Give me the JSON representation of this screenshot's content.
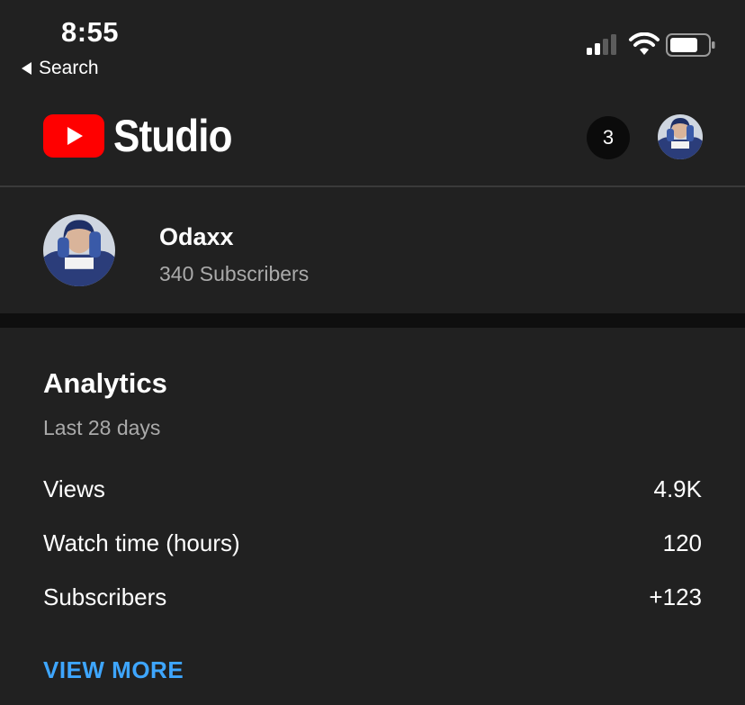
{
  "status_bar": {
    "time": "8:55",
    "back_label": "Search",
    "signal_icon": "cellular-signal-icon",
    "wifi_icon": "wifi-icon",
    "battery_icon": "battery-icon"
  },
  "header": {
    "logo_text": "Studio",
    "logo_icon": "youtube-play-icon",
    "notification_count": "3",
    "brand_color": "#ff0000"
  },
  "channel": {
    "name": "Odaxx",
    "subscribers": "340 Subscribers"
  },
  "analytics": {
    "title": "Analytics",
    "range": "Last 28 days",
    "metrics": [
      {
        "label": "Views",
        "value": "4.9K"
      },
      {
        "label": "Watch time (hours)",
        "value": "120"
      },
      {
        "label": "Subscribers",
        "value": "+123"
      }
    ],
    "view_more_label": "VIEW MORE",
    "link_color": "#3ea6ff"
  }
}
